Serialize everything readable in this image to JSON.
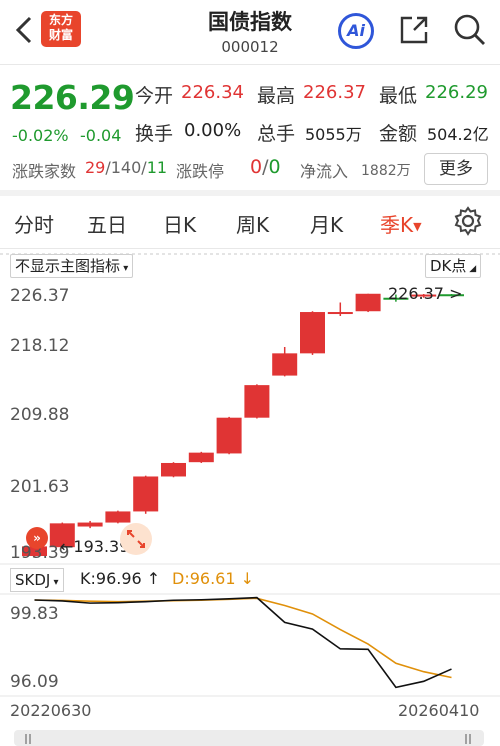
{
  "header": {
    "logo_line1": "东方",
    "logo_line2": "财富",
    "title": "国债指数",
    "code": "000012",
    "ai_label": "Ai"
  },
  "quote": {
    "price": "226.29",
    "change_pct": "-0.02%",
    "change_abs": "-0.04",
    "open_label": "今开",
    "open_value": "226.34",
    "high_label": "最高",
    "high_value": "226.37",
    "low_label": "最低",
    "low_value": "226.29",
    "turnover_label": "换手",
    "turnover_value": "0.00%",
    "volume_label": "总手",
    "volume_value": "5055万",
    "amount_label": "金额",
    "amount_value": "504.2亿",
    "updown_label": "涨跌家数",
    "up_count": "29",
    "sep1": "/",
    "flat_count": "140",
    "sep2": "/",
    "down_count": "11",
    "limit_label": "涨跌停",
    "limit_up": "0",
    "limit_sep": "/",
    "limit_down": "0",
    "netflow_label": "净流入",
    "netflow_value": "1882万",
    "more_label": "更多"
  },
  "tabs": [
    {
      "label": "分时"
    },
    {
      "label": "五日"
    },
    {
      "label": "日K"
    },
    {
      "label": "周K"
    },
    {
      "label": "月K"
    },
    {
      "label": "季K",
      "active": true
    }
  ],
  "indicator": {
    "main_selector": "不显示主图指标",
    "dk_selector": "DK点",
    "dk_marker": "226.37 >",
    "min_marker": "193.39",
    "sub_indicator": "SKDJ",
    "k_text": "K:96.96",
    "d_text": "D:96.61"
  },
  "colors": {
    "up": "#e03434",
    "down": "#1f9a2e",
    "accent": "#e8452c",
    "k_line": "#111111",
    "d_line": "#e0900a"
  },
  "chart_data": {
    "type": "candlestick",
    "price_axis": {
      "ticks": [
        "226.37",
        "218.12",
        "209.88",
        "201.63",
        "193.39"
      ],
      "range": [
        193.39,
        226.37
      ]
    },
    "candles": [
      {
        "open": 193.39,
        "close": 194.6,
        "high": 195.0,
        "low": 193.3
      },
      {
        "open": 194.5,
        "close": 197.5,
        "high": 197.6,
        "low": 194.3
      },
      {
        "open": 197.1,
        "close": 197.6,
        "high": 197.8,
        "low": 196.9
      },
      {
        "open": 197.6,
        "close": 199.0,
        "high": 199.1,
        "low": 197.5
      },
      {
        "open": 199.0,
        "close": 203.4,
        "high": 203.5,
        "low": 198.7
      },
      {
        "open": 203.4,
        "close": 205.1,
        "high": 205.2,
        "low": 203.3
      },
      {
        "open": 205.2,
        "close": 206.4,
        "high": 206.5,
        "low": 205.1
      },
      {
        "open": 206.3,
        "close": 210.8,
        "high": 210.9,
        "low": 206.2
      },
      {
        "open": 210.8,
        "close": 214.9,
        "high": 215.0,
        "low": 210.7
      },
      {
        "open": 216.1,
        "close": 218.9,
        "high": 219.7,
        "low": 216.0
      },
      {
        "open": 218.9,
        "close": 224.1,
        "high": 224.2,
        "low": 218.7
      },
      {
        "open": 224.0,
        "close": 224.1,
        "high": 225.3,
        "low": 223.6
      },
      {
        "open": 224.2,
        "close": 226.4,
        "high": 226.4,
        "low": 224.1
      },
      {
        "open": 225.9,
        "close": 225.7,
        "high": 226.3,
        "low": 225.4
      },
      {
        "open": 226.1,
        "close": 226.3,
        "high": 226.37,
        "low": 225.9
      },
      {
        "open": 226.34,
        "close": 226.29,
        "high": 226.37,
        "low": 226.29
      }
    ],
    "skdj": {
      "axis_ticks": [
        "99.83",
        "96.09"
      ],
      "range": [
        96.09,
        99.83
      ],
      "k": [
        99.83,
        99.79,
        99.7,
        99.72,
        99.76,
        99.82,
        99.84,
        99.88,
        99.93,
        98.9,
        98.62,
        97.8,
        97.78,
        96.2,
        96.45,
        96.96
      ],
      "d": [
        99.83,
        99.81,
        99.78,
        99.76,
        99.78,
        99.8,
        99.82,
        99.86,
        99.9,
        99.6,
        99.25,
        98.6,
        98.0,
        97.2,
        96.85,
        96.61
      ]
    },
    "dates": [
      "20220630",
      "20260410"
    ]
  }
}
